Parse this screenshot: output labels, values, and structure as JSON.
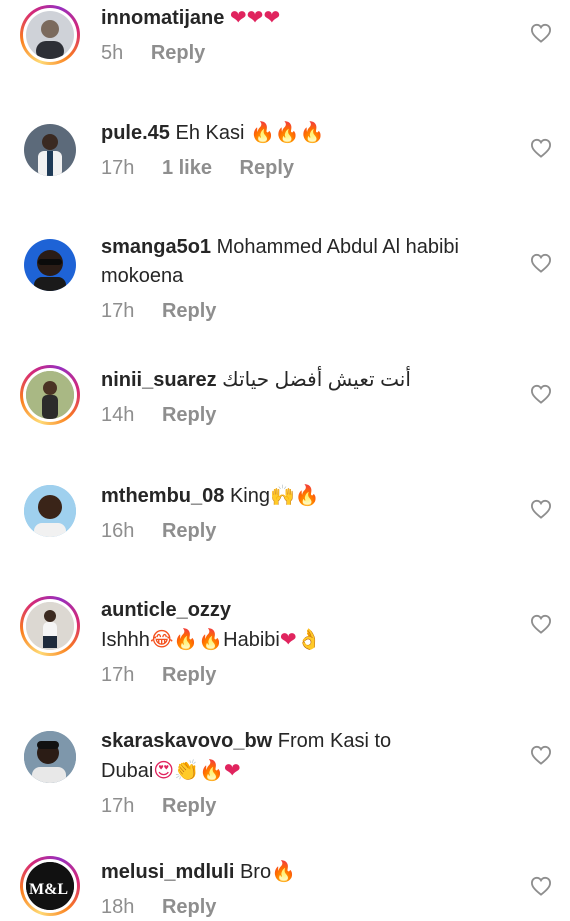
{
  "comments": [
    {
      "username": "innomatijane",
      "text": "",
      "emoji": "❤❤❤",
      "time": "5h",
      "likes": "",
      "reply": "Reply",
      "story_ring": true,
      "avatar_color": "#cfd2d8",
      "avatar_icon": "person-avatar"
    },
    {
      "username": "pule.45",
      "text": "Eh Kasi",
      "emoji": "🔥🔥🔥",
      "time": "17h",
      "likes": "1 like",
      "reply": "Reply",
      "story_ring": false,
      "avatar_color": "#5c6a7a",
      "avatar_icon": "person-avatar"
    },
    {
      "username": "smanga5o1",
      "text": "Mohammed Abdul Al habibi",
      "text2": "mokoena",
      "time": "17h",
      "likes": "",
      "reply": "Reply",
      "story_ring": false,
      "avatar_color": "#1e63d6",
      "avatar_icon": "person-avatar"
    },
    {
      "username": "ninii_suarez",
      "text": "أنت تعيش أفضل حياتك",
      "time": "14h",
      "likes": "",
      "reply": "Reply",
      "story_ring": true,
      "avatar_color": "#9aa876",
      "avatar_icon": "person-avatar"
    },
    {
      "username": "mthembu_08",
      "text": "King",
      "emoji": "🙌🔥",
      "time": "16h",
      "likes": "",
      "reply": "Reply",
      "story_ring": false,
      "avatar_color": "#8ec2e6",
      "avatar_icon": "person-avatar"
    },
    {
      "username": "aunticle_ozzy",
      "text": "Ishhh",
      "emoji": "😂🔥🔥",
      "text_b": "Habibi",
      "emoji_b": "❤👌",
      "time": "17h",
      "likes": "",
      "reply": "Reply",
      "story_ring": true,
      "avatar_color": "#d8d4cf",
      "avatar_icon": "person-avatar"
    },
    {
      "username": "skaraskavovo_bw",
      "text": "From Kasi to",
      "text2": "Dubai",
      "emoji2": "😍👏🔥❤",
      "time": "17h",
      "likes": "",
      "reply": "Reply",
      "story_ring": false,
      "avatar_color": "#6f8aa0",
      "avatar_icon": "person-avatar"
    },
    {
      "username": "melusi_mdluli",
      "text": "Bro",
      "emoji": "🔥",
      "time": "18h",
      "likes": "",
      "reply": "Reply",
      "story_ring": true,
      "avatar_color": "#111111",
      "avatar_logo": "M&L",
      "avatar_icon": "brand-logo-avatar"
    }
  ],
  "icons": {
    "like": "heart-outline-icon"
  },
  "colors": {
    "text": "#262626",
    "muted": "#8e8e8e",
    "fire": "#f4511e",
    "heart": "#e0245e"
  }
}
